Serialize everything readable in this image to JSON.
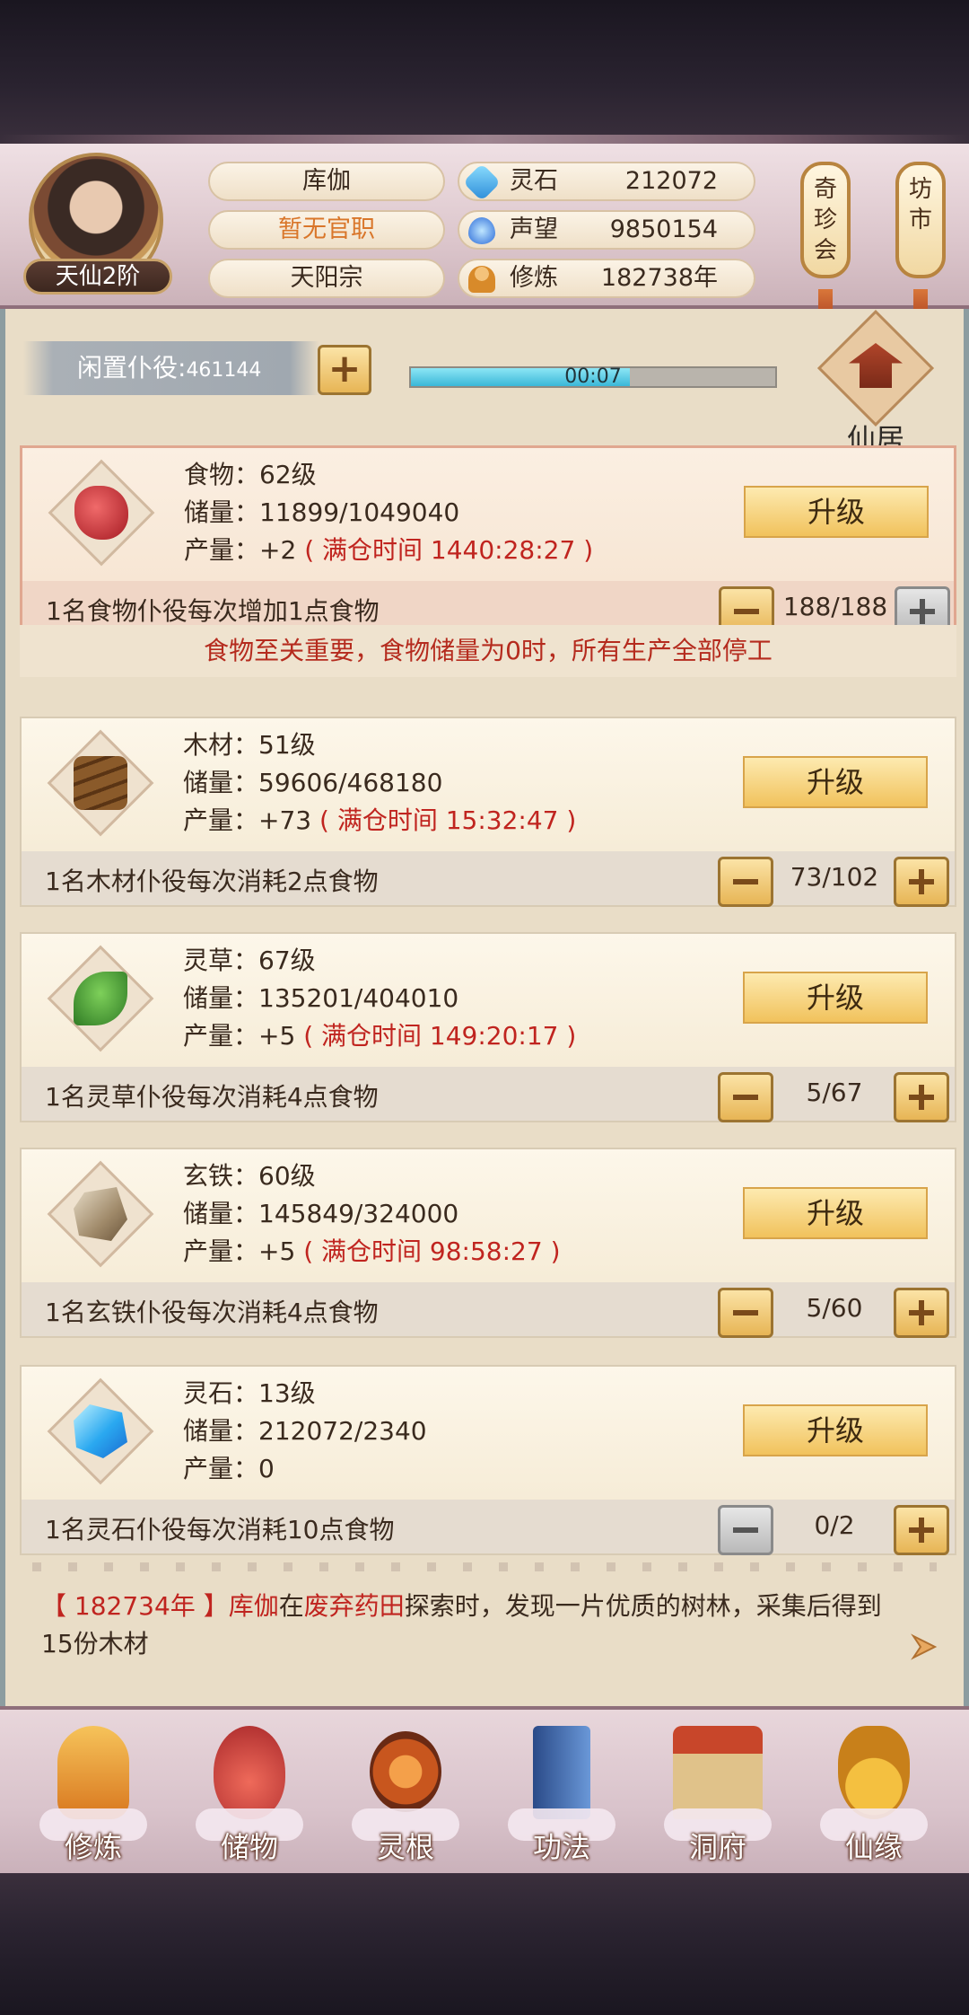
{
  "header": {
    "rank_tag": "天仙2阶",
    "name": "库伽",
    "title": "暂无官职",
    "sect": "天阳宗",
    "stats": [
      {
        "label": "灵石",
        "value": "212072",
        "icon": "spirit-stone-icon",
        "color": "#3aa0e0"
      },
      {
        "label": "声望",
        "value": "9850154",
        "icon": "reputation-icon",
        "color": "#3a7ad8"
      },
      {
        "label": "修炼",
        "value": "182738年",
        "icon": "cultivation-icon",
        "color": "#d89a3a"
      }
    ],
    "side_buttons": [
      "奇珍会",
      "坊市"
    ]
  },
  "idle": {
    "label": "闲置仆役:",
    "count": "461144",
    "timer": "00:07",
    "progress": 0.6
  },
  "xianju_label": "仙居",
  "resources": [
    {
      "name_line": "食物：62级",
      "storage": "储量：11899/1049040",
      "output": "产量：+2",
      "full": "( 满仓时间 1440:28:27 )",
      "desc": "1名食物仆役每次增加1点食物",
      "count": "188/188",
      "upgrade": "升级",
      "icon": "meat-icon",
      "minus_disabled": false,
      "plus_disabled": true
    },
    {
      "name_line": "木材：51级",
      "storage": "储量：59606/468180",
      "output": "产量：+73",
      "full": "( 满仓时间 15:32:47 )",
      "desc": "1名木材仆役每次消耗2点食物",
      "count": "73/102",
      "upgrade": "升级",
      "icon": "wood-icon",
      "minus_disabled": false,
      "plus_disabled": false
    },
    {
      "name_line": "灵草：67级",
      "storage": "储量：135201/404010",
      "output": "产量：+5",
      "full": "( 满仓时间 149:20:17 )",
      "desc": "1名灵草仆役每次消耗4点食物",
      "count": "5/67",
      "upgrade": "升级",
      "icon": "herb-icon",
      "minus_disabled": false,
      "plus_disabled": false
    },
    {
      "name_line": "玄铁：60级",
      "storage": "储量：145849/324000",
      "output": "产量：+5",
      "full": "( 满仓时间 98:58:27 )",
      "desc": "1名玄铁仆役每次消耗4点食物",
      "count": "5/60",
      "upgrade": "升级",
      "icon": "iron-icon",
      "minus_disabled": false,
      "plus_disabled": false
    },
    {
      "name_line": "灵石：13级",
      "storage": "储量：212072/2340",
      "output": "产量：0",
      "full": "",
      "desc": "1名灵石仆役每次消耗10点食物",
      "count": "0/2",
      "upgrade": "升级",
      "icon": "crystal-icon",
      "minus_disabled": true,
      "plus_disabled": false
    }
  ],
  "warning": "食物至关重要，食物储量为0时，所有生产全部停工",
  "log": {
    "year": "【 182734年 】",
    "actor": "库伽",
    "mid1": "在",
    "place": "废弃药田",
    "text": "探索时，发现一片优质的树林，采集后得到15份木材"
  },
  "nav": [
    {
      "label": "修炼",
      "icon": "cultivate-icon",
      "color": "#e89a3a"
    },
    {
      "label": "储物",
      "icon": "bag-icon",
      "color": "#d8504a"
    },
    {
      "label": "灵根",
      "icon": "spirit-root-icon",
      "color": "#c8561e"
    },
    {
      "label": "功法",
      "icon": "book-icon",
      "color": "#4a78b8"
    },
    {
      "label": "洞府",
      "icon": "cave-icon",
      "color": "#c9a25a"
    },
    {
      "label": "仙缘",
      "icon": "gourd-icon",
      "color": "#e0a030"
    }
  ]
}
